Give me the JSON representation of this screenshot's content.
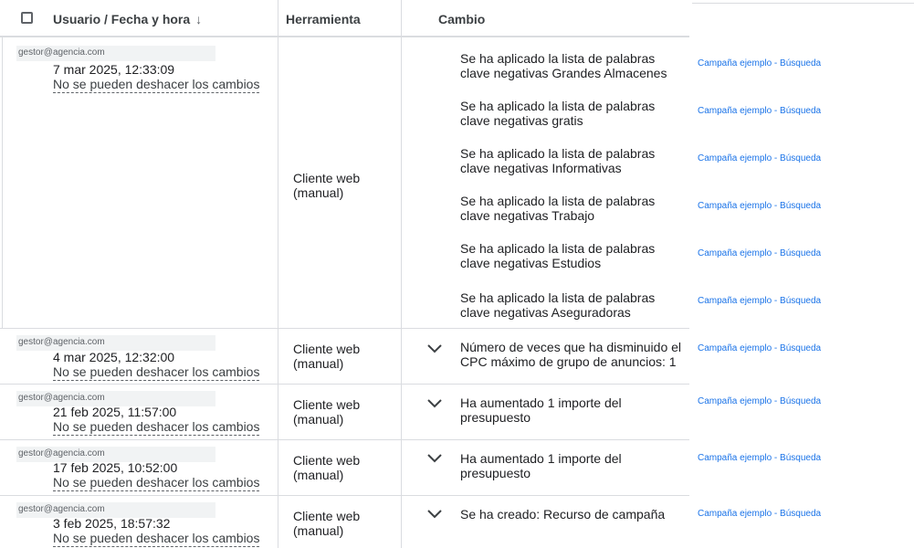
{
  "header": {
    "col_user_date": "Usuario / Fecha y hora",
    "sort_arrow": "↓",
    "col_tool": "Herramienta",
    "col_change": "Cambio"
  },
  "undo_label": "No se pueden deshacer los cambios",
  "tool_label_line1": "Cliente web",
  "tool_label_line2": "(manual)",
  "campaign_link": "Campaña ejemplo - Búsqueda",
  "rows": [
    {
      "email": "gestor@agencia.com",
      "datetime": "7 mar 2025, 12:33:09",
      "changes": [
        {
          "line1": "Se ha aplicado la lista de palabras",
          "line2": "clave negativas Grandes Almacenes"
        },
        {
          "line1": "Se ha aplicado la lista de palabras",
          "line2": "clave negativas gratis"
        },
        {
          "line1": "Se ha aplicado la lista de palabras",
          "line2": "clave negativas Informativas"
        },
        {
          "line1": "Se ha aplicado la lista de palabras",
          "line2": "clave negativas Trabajo"
        },
        {
          "line1": "Se ha aplicado la lista de palabras",
          "line2": "clave negativas Estudios"
        },
        {
          "line1": "Se ha aplicado la lista de palabras",
          "line2": "clave negativas Aseguradoras"
        }
      ]
    },
    {
      "email": "gestor@agencia.com",
      "datetime": "4 mar 2025, 12:32:00",
      "changes": [
        {
          "line1": "Número de veces que ha disminuido el",
          "line2": "CPC máximo de grupo de anuncios: 1"
        }
      ]
    },
    {
      "email": "gestor@agencia.com",
      "datetime": "21 feb 2025, 11:57:00",
      "changes": [
        {
          "line1": "Ha aumentado 1 importe del",
          "line2": "presupuesto"
        }
      ]
    },
    {
      "email": "gestor@agencia.com",
      "datetime": "17 feb 2025, 10:52:00",
      "changes": [
        {
          "line1": "Ha aumentado 1 importe del",
          "line2": "presupuesto"
        }
      ]
    },
    {
      "email": "gestor@agencia.com",
      "datetime": "3 feb 2025, 18:57:32",
      "changes": [
        {
          "line1": "Se ha creado: Recurso de campaña",
          "line2": ""
        }
      ]
    }
  ],
  "icons": {
    "expand": "chevron-down-icon",
    "select_all": "checkbox-icon",
    "sort": "arrow-down-icon"
  }
}
